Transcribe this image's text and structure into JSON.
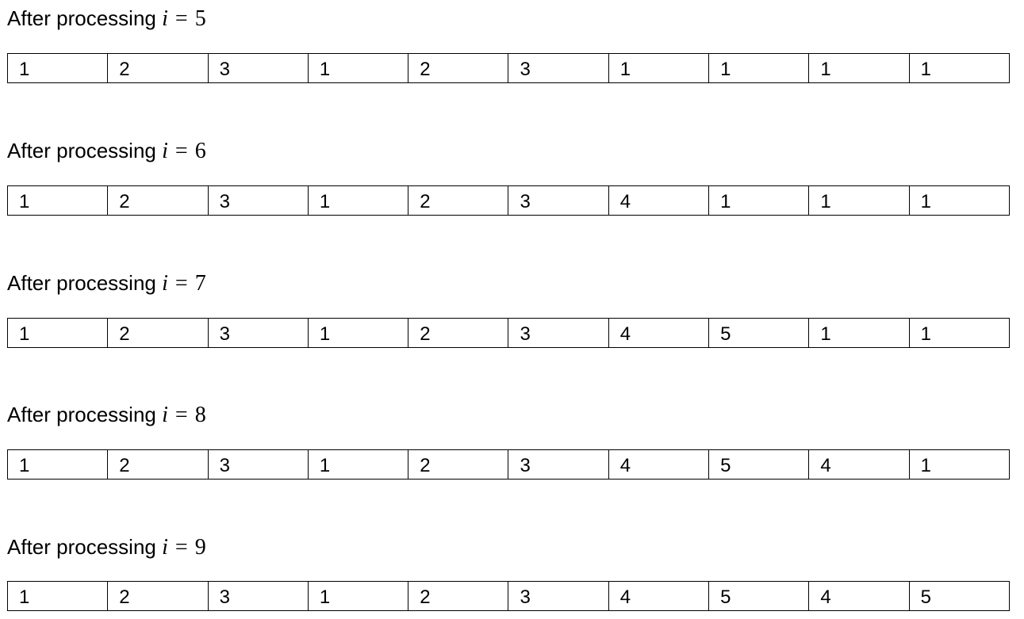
{
  "document": {
    "sections": [
      {
        "heading_prefix": "After processing",
        "var": "i",
        "eq": "=",
        "value": "5",
        "cells": [
          "1",
          "2",
          "3",
          "1",
          "2",
          "3",
          "1",
          "1",
          "1",
          "1"
        ]
      },
      {
        "heading_prefix": "After processing",
        "var": "i",
        "eq": "=",
        "value": "6",
        "cells": [
          "1",
          "2",
          "3",
          "1",
          "2",
          "3",
          "4",
          "1",
          "1",
          "1"
        ]
      },
      {
        "heading_prefix": "After processing",
        "var": "i",
        "eq": "=",
        "value": "7",
        "cells": [
          "1",
          "2",
          "3",
          "1",
          "2",
          "3",
          "4",
          "5",
          "1",
          "1"
        ]
      },
      {
        "heading_prefix": "After processing",
        "var": "i",
        "eq": "=",
        "value": "8",
        "cells": [
          "1",
          "2",
          "3",
          "1",
          "2",
          "3",
          "4",
          "5",
          "4",
          "1"
        ]
      },
      {
        "heading_prefix": "After processing",
        "var": "i",
        "eq": "=",
        "value": "9",
        "cells": [
          "1",
          "2",
          "3",
          "1",
          "2",
          "3",
          "4",
          "5",
          "4",
          "5"
        ]
      }
    ]
  }
}
